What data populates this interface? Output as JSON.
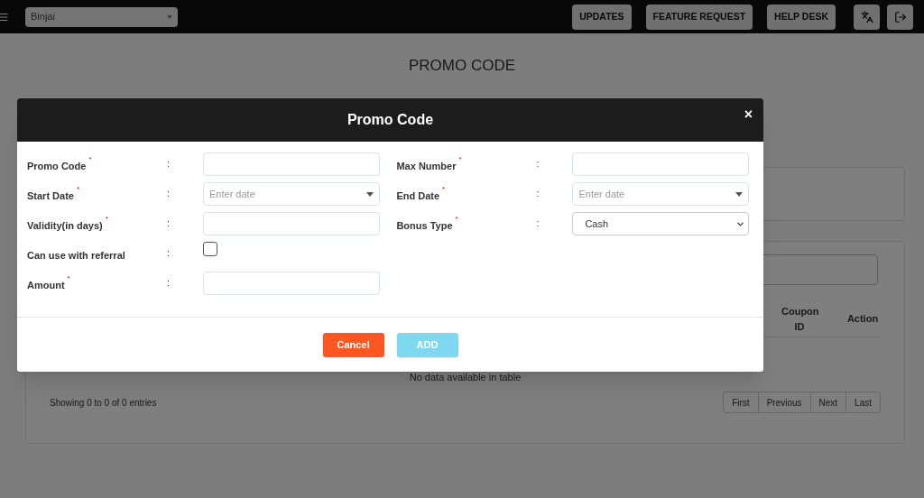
{
  "top_bar": {
    "location_select": {
      "value": "Binjai"
    },
    "buttons": [
      "UPDATES",
      "FEATURE REQUEST",
      "HELP DESK"
    ]
  },
  "page": {
    "title": "PROMO CODE",
    "table": {
      "columns": [
        "Coupon ID",
        "Action"
      ],
      "empty_message": "No data available in table",
      "info": "Showing 0 to 0 of 0 entries",
      "pagination": [
        "First",
        "Previous",
        "Next",
        "Last"
      ]
    }
  },
  "modal": {
    "title": "Promo Code",
    "close": "×",
    "left_fields": [
      {
        "kind": "text",
        "label": "Promo Code",
        "required_mark": "*",
        "separator": ":"
      },
      {
        "kind": "date",
        "label": "Start Date",
        "required_mark": "*",
        "separator": ":",
        "placeholder": "Enter date"
      },
      {
        "kind": "text",
        "label": "Validity(in days)",
        "required_mark": "*",
        "separator": ":"
      },
      {
        "kind": "checkbox",
        "label": "Can use with referral",
        "separator": ":",
        "checked": false
      },
      {
        "kind": "text",
        "label": "Amount",
        "required_mark": "*",
        "separator": ":"
      }
    ],
    "right_fields": [
      {
        "kind": "text",
        "label": "Max Number",
        "required_mark": "*",
        "separator": ":"
      },
      {
        "kind": "date",
        "label": "End Date",
        "required_mark": "*",
        "separator": ":",
        "placeholder": "Enter date"
      },
      {
        "kind": "select",
        "label": "Bonus Type",
        "required_mark": "*",
        "separator": ":",
        "value": "Cash"
      }
    ],
    "buttons": [
      {
        "label": "Cancel",
        "kind": "cancel"
      },
      {
        "label": "ADD",
        "kind": "primary"
      }
    ]
  }
}
